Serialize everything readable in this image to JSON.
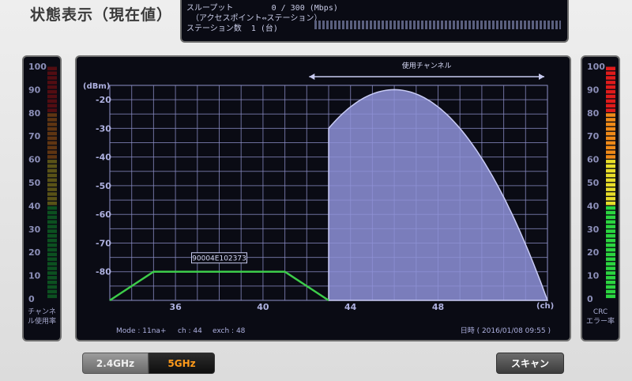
{
  "page_title": "状態表示（現在値）",
  "throughput": {
    "label": "スループット",
    "value": "0 / 300 (Mbps)",
    "sub_label": "（アクセスポイント⇔ステーション）",
    "stations_label": "ステーション数",
    "stations_value": "1 (台)",
    "level": 0
  },
  "left_meter": {
    "ticks": [
      "100",
      "90",
      "80",
      "70",
      "60",
      "50",
      "40",
      "30",
      "20",
      "10",
      "0"
    ],
    "label_line1": "チャンネ",
    "label_line2": "ル使用率",
    "colors": {
      "green": "#0f8a2a",
      "yellow": "#9a8e1a",
      "orange": "#a65a10",
      "red": "#8e1111"
    },
    "level": 0
  },
  "right_meter": {
    "ticks": [
      "100",
      "90",
      "80",
      "70",
      "60",
      "50",
      "40",
      "30",
      "20",
      "10",
      "0"
    ],
    "label_line1": "CRC",
    "label_line2": "エラー率",
    "colors": {
      "green": "#2bd640",
      "yellow": "#e8de2a",
      "orange": "#f08a18",
      "red": "#e01b1b"
    },
    "level": 100
  },
  "chart_data": {
    "type": "area",
    "title": "使用チャンネル",
    "ylabel": "(dBm)",
    "xlabel": "(ch)",
    "ylim": [
      -90,
      -15
    ],
    "xlim": [
      33,
      53
    ],
    "y_ticks": [
      -20,
      -30,
      -40,
      -50,
      -60,
      -70,
      -80
    ],
    "x_ticks": [
      36,
      40,
      44,
      48
    ],
    "used_channel_range": [
      42,
      53
    ],
    "series": [
      {
        "name": "90004E102373",
        "style": "line",
        "color": "#3dcc4a",
        "x": [
          33,
          35,
          41,
          43
        ],
        "y": [
          -90,
          -80,
          -80,
          -90
        ]
      },
      {
        "name": "",
        "style": "area",
        "color": "#8e92d8",
        "center": 46,
        "peak": -16.5,
        "x_start": 43,
        "x_end": 53,
        "base": -90
      }
    ],
    "annotation": "90004E102373",
    "grid": true
  },
  "status": {
    "mode": "Mode : 11na+",
    "ch": "ch : 44",
    "exch": "exch : 48",
    "datetime": "日時 ( 2016/01/08 09:55 )"
  },
  "bands": {
    "band_24": "2.4GHz",
    "band_5": "5GHz",
    "selected": "5GHz"
  },
  "scan_label": "スキャン"
}
